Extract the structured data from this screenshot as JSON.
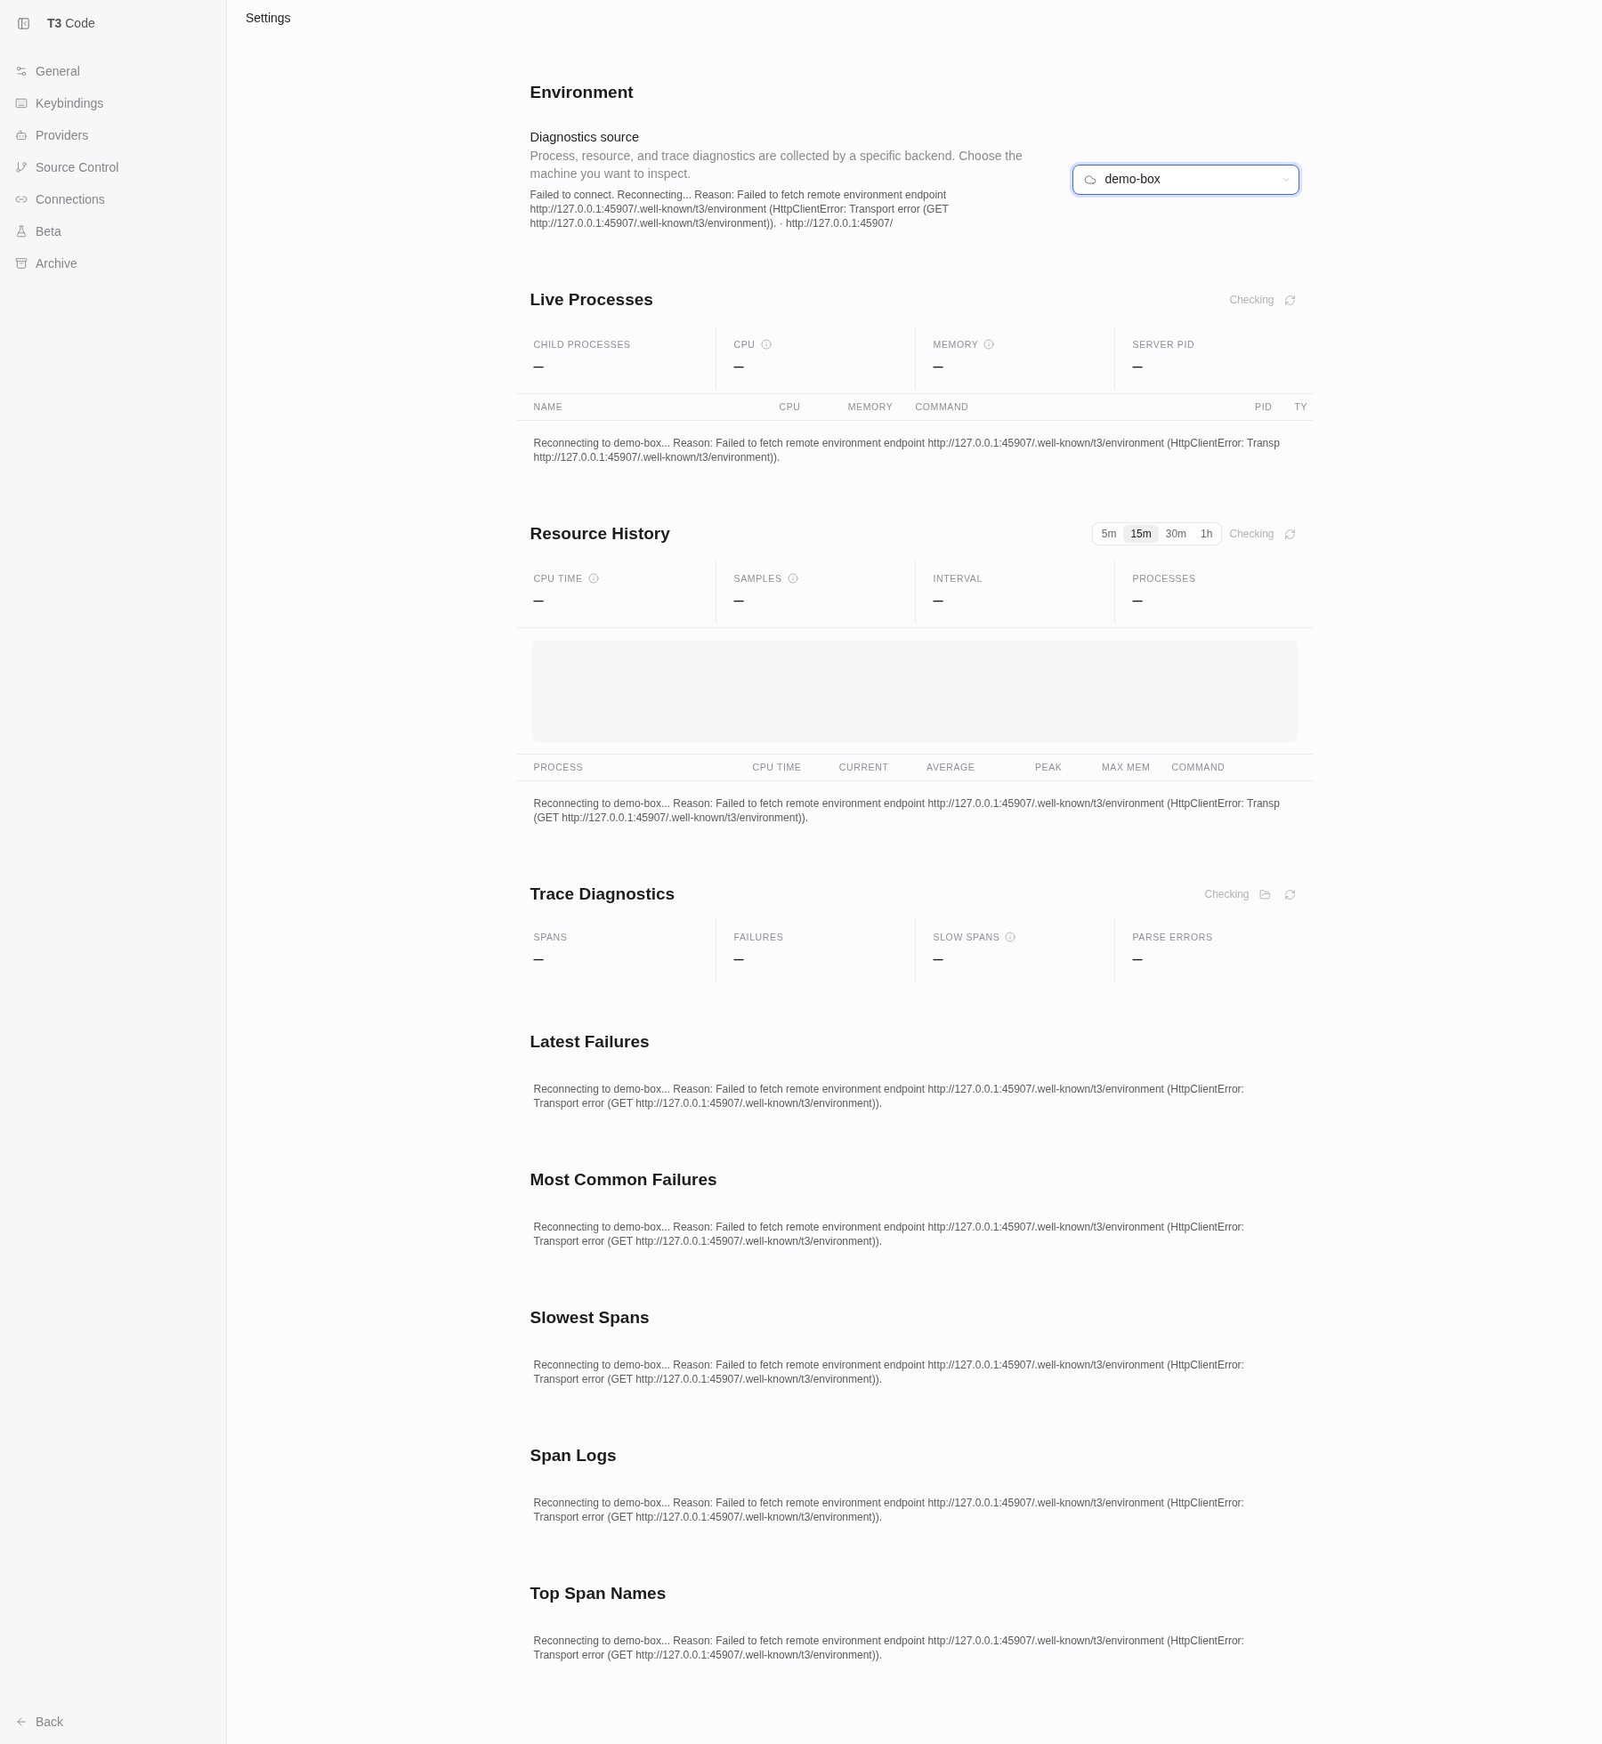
{
  "sidebar": {
    "app_title": "**T3** Code",
    "items": [
      {
        "label": "General",
        "selected": false
      },
      {
        "label": "Keybindings",
        "selected": false
      },
      {
        "label": "Providers",
        "selected": false
      },
      {
        "label": "Source Control",
        "selected": false
      },
      {
        "label": "Connections",
        "selected": false
      },
      {
        "label": "Beta",
        "selected": false
      },
      {
        "label": "Archive",
        "selected": false
      }
    ],
    "back": "Back"
  },
  "header": {
    "title": "Settings"
  },
  "sections": [
    {
      "kind": "environment",
      "title": "Environment",
      "field": {
        "label": "Diagnostics source",
        "description": "Process, resource, and trace diagnostics are collected by a specific backend. Choose the machine you want to inspect.",
        "error": "Failed to connect. Reconnecting... Reason: Failed to fetch remote environment endpoint http://127.0.0.1:45907/.well-known/t3/environment (HttpClientError: Transport error (GET http://127.0.0.1:45907/.well-known/t3/environment)). · http://127.0.0.1:45907/"
      },
      "select": {
        "value": "demo-box",
        "focused": true
      }
    },
    {
      "kind": "processes",
      "title": "Live Processes",
      "status": "Checking",
      "stats": [
        {
          "label": "CHILD PROCESSES",
          "value": "–",
          "info": false
        },
        {
          "label": "CPU",
          "value": "–",
          "info": true
        },
        {
          "label": "MEMORY",
          "value": "–",
          "info": true
        },
        {
          "label": "SERVER PID",
          "value": "–",
          "info": false
        }
      ],
      "table": {
        "columns": [
          "NAME",
          "CPU",
          "MEMORY",
          "COMMAND",
          "PID",
          "TY"
        ],
        "message_lines": [
          "Reconnecting to demo-box... Reason: Failed to fetch remote environment endpoint http://127.0.0.1:45907/.well-known/t3/environment (HttpClientError: Transp",
          "http://127.0.0.1:45907/.well-known/t3/environment))."
        ]
      }
    },
    {
      "kind": "history",
      "title": "Resource History",
      "ranges": [
        {
          "label": "5m",
          "selected": false
        },
        {
          "label": "15m",
          "selected": true
        },
        {
          "label": "30m",
          "selected": false
        },
        {
          "label": "1h",
          "selected": false
        }
      ],
      "status": "Checking",
      "stats": [
        {
          "label": "CPU TIME",
          "value": "–",
          "info": true
        },
        {
          "label": "SAMPLES",
          "value": "–",
          "info": true
        },
        {
          "label": "INTERVAL",
          "value": "–",
          "info": false
        },
        {
          "label": "PROCESSES",
          "value": "–",
          "info": false
        }
      ],
      "table": {
        "columns": [
          "PROCESS",
          "CPU TIME",
          "CURRENT",
          "AVERAGE",
          "PEAK",
          "MAX MEM",
          "COMMAND"
        ],
        "message_lines": [
          "Reconnecting to demo-box... Reason: Failed to fetch remote environment endpoint http://127.0.0.1:45907/.well-known/t3/environment (HttpClientError: Transp",
          "(GET http://127.0.0.1:45907/.well-known/t3/environment))."
        ]
      }
    },
    {
      "kind": "trace",
      "title": "Trace Diagnostics",
      "status": "Checking",
      "stats": [
        {
          "label": "SPANS",
          "value": "–",
          "info": false
        },
        {
          "label": "FAILURES",
          "value": "–",
          "info": false
        },
        {
          "label": "SLOW SPANS",
          "value": "–",
          "info": true
        },
        {
          "label": "PARSE ERRORS",
          "value": "–",
          "info": false
        }
      ]
    },
    {
      "kind": "list",
      "title": "Latest Failures",
      "message": "Reconnecting to demo-box... Reason: Failed to fetch remote environment endpoint http://127.0.0.1:45907/.well-known/t3/environment (HttpClientError: Transport error (GET http://127.0.0.1:45907/.well-known/t3/environment))."
    },
    {
      "kind": "list",
      "title": "Most Common Failures",
      "message": "Reconnecting to demo-box... Reason: Failed to fetch remote environment endpoint http://127.0.0.1:45907/.well-known/t3/environment (HttpClientError: Transport error (GET http://127.0.0.1:45907/.well-known/t3/environment))."
    },
    {
      "kind": "list",
      "title": "Slowest Spans",
      "message": "Reconnecting to demo-box... Reason: Failed to fetch remote environment endpoint http://127.0.0.1:45907/.well-known/t3/environment (HttpClientError: Transport error (GET http://127.0.0.1:45907/.well-known/t3/environment))."
    },
    {
      "kind": "list",
      "title": "Span Logs",
      "message": "Reconnecting to demo-box... Reason: Failed to fetch remote environment endpoint http://127.0.0.1:45907/.well-known/t3/environment (HttpClientError: Transport error (GET http://127.0.0.1:45907/.well-known/t3/environment))."
    },
    {
      "kind": "list",
      "title": "Top Span Names",
      "message": "Reconnecting to demo-box... Reason: Failed to fetch remote environment endpoint http://127.0.0.1:45907/.well-known/t3/environment (HttpClientError: Transport error (GET http://127.0.0.1:45907/.well-known/t3/environment))."
    }
  ]
}
